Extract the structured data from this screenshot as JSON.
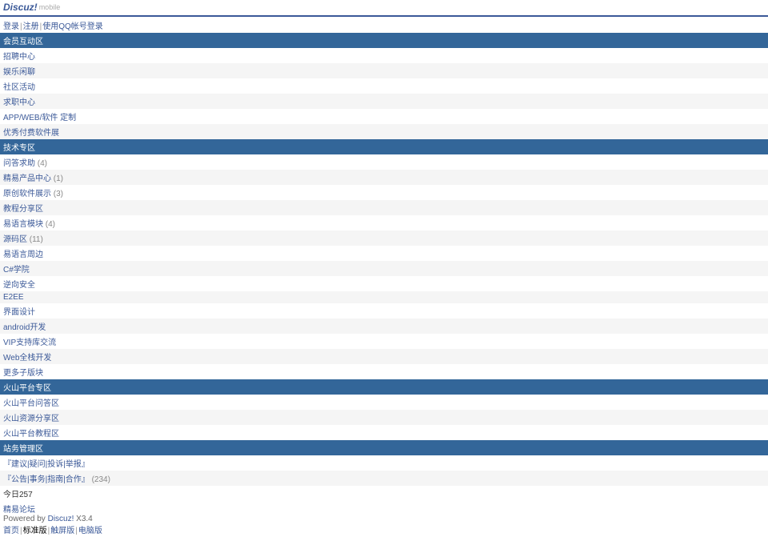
{
  "header": {
    "logo": "Discuz!",
    "mobile": "mobile"
  },
  "auth": {
    "login": "登录",
    "register": "注册",
    "qq_login": "使用QQ帐号登录"
  },
  "sections": [
    {
      "title": "会员互动区",
      "forums": [
        {
          "name": "招聘中心",
          "count": ""
        },
        {
          "name": "娱乐闲聊",
          "count": ""
        },
        {
          "name": "社区活动",
          "count": ""
        },
        {
          "name": "求职中心",
          "count": ""
        },
        {
          "name": "APP/WEB/软件 定制",
          "count": ""
        },
        {
          "name": "优秀付费软件展",
          "count": ""
        }
      ]
    },
    {
      "title": "技术专区",
      "forums": [
        {
          "name": "问答求助",
          "count": "(4)"
        },
        {
          "name": "精易产品中心",
          "count": "(1)"
        },
        {
          "name": "原创软件展示",
          "count": "(3)"
        },
        {
          "name": "教程分享区",
          "count": ""
        },
        {
          "name": "易语言模块",
          "count": "(4)"
        },
        {
          "name": "源码区",
          "count": "(11)"
        },
        {
          "name": "易语言周边",
          "count": ""
        },
        {
          "name": "C#学院",
          "count": ""
        },
        {
          "name": "逆向安全",
          "count": ""
        },
        {
          "name": "E2EE",
          "count": ""
        },
        {
          "name": "界面设计",
          "count": ""
        },
        {
          "name": "android开发",
          "count": ""
        },
        {
          "name": "VIP支持库交流",
          "count": ""
        },
        {
          "name": "Web全栈开发",
          "count": ""
        },
        {
          "name": "更多子版块",
          "count": ""
        }
      ]
    },
    {
      "title": "火山平台专区",
      "forums": [
        {
          "name": "火山平台问答区",
          "count": ""
        },
        {
          "name": "火山资源分享区",
          "count": ""
        },
        {
          "name": "火山平台教程区",
          "count": ""
        }
      ]
    },
    {
      "title": "站务管理区",
      "forums": [
        {
          "name": "『建议|疑问|投诉|举报』",
          "count": ""
        },
        {
          "name": "『公告|事务|指南|合作』",
          "count": "(234)"
        }
      ]
    }
  ],
  "stats": {
    "today": "今日257"
  },
  "footer": {
    "site_name": "精易论坛",
    "powered_by": "Powered by ",
    "discuz": "Discuz!",
    "version": " X3.4",
    "nav_home": "首页",
    "nav_standard": "标准版",
    "nav_touch": "触屏版",
    "nav_desktop": "电脑版"
  }
}
